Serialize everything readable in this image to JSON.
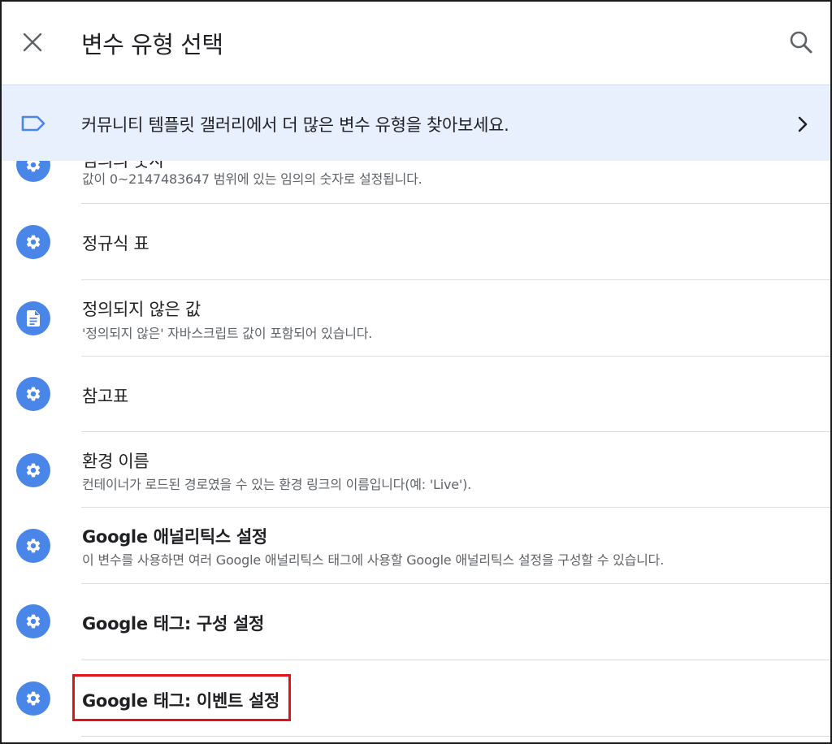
{
  "header": {
    "title": "변수 유형 선택",
    "close_icon": "close-icon",
    "search_icon": "search-icon"
  },
  "banner": {
    "text": "커뮤니티 템플릿 갤러리에서 더 많은 변수 유형을 찾아보세요.",
    "icon": "label-tag-icon",
    "chevron": "chevron-right-icon"
  },
  "items": [
    {
      "title": "임의의 숫자",
      "desc": "값이 0~2147483647 범위에 있는 임의의 숫자로 설정됩니다.",
      "icon": "gear-icon"
    },
    {
      "title": "정규식 표",
      "desc": "",
      "icon": "gear-icon"
    },
    {
      "title": "정의되지 않은 값",
      "desc": "'정의되지 않은' 자바스크립트 값이 포함되어 있습니다.",
      "icon": "document-icon"
    },
    {
      "title": "참고표",
      "desc": "",
      "icon": "gear-icon"
    },
    {
      "title": "환경 이름",
      "desc": "컨테이너가 로드된 경로였을 수 있는 환경 링크의 이름입니다(예: 'Live').",
      "icon": "gear-icon"
    },
    {
      "title": "Google 애널리틱스 설정",
      "desc": "이 변수를 사용하면 여러 Google 애널리틱스 태그에 사용할 Google 애널리틱스 설정을 구성할 수 있습니다.",
      "icon": "gear-icon"
    },
    {
      "title": "Google 태그: 구성 설정",
      "desc": "",
      "icon": "gear-icon"
    },
    {
      "title": "Google 태그: 이벤트 설정",
      "desc": "",
      "icon": "gear-icon"
    }
  ],
  "colors": {
    "accent": "#4a86e8",
    "banner_bg": "#e8f0fe",
    "highlight": "#e0121b"
  }
}
